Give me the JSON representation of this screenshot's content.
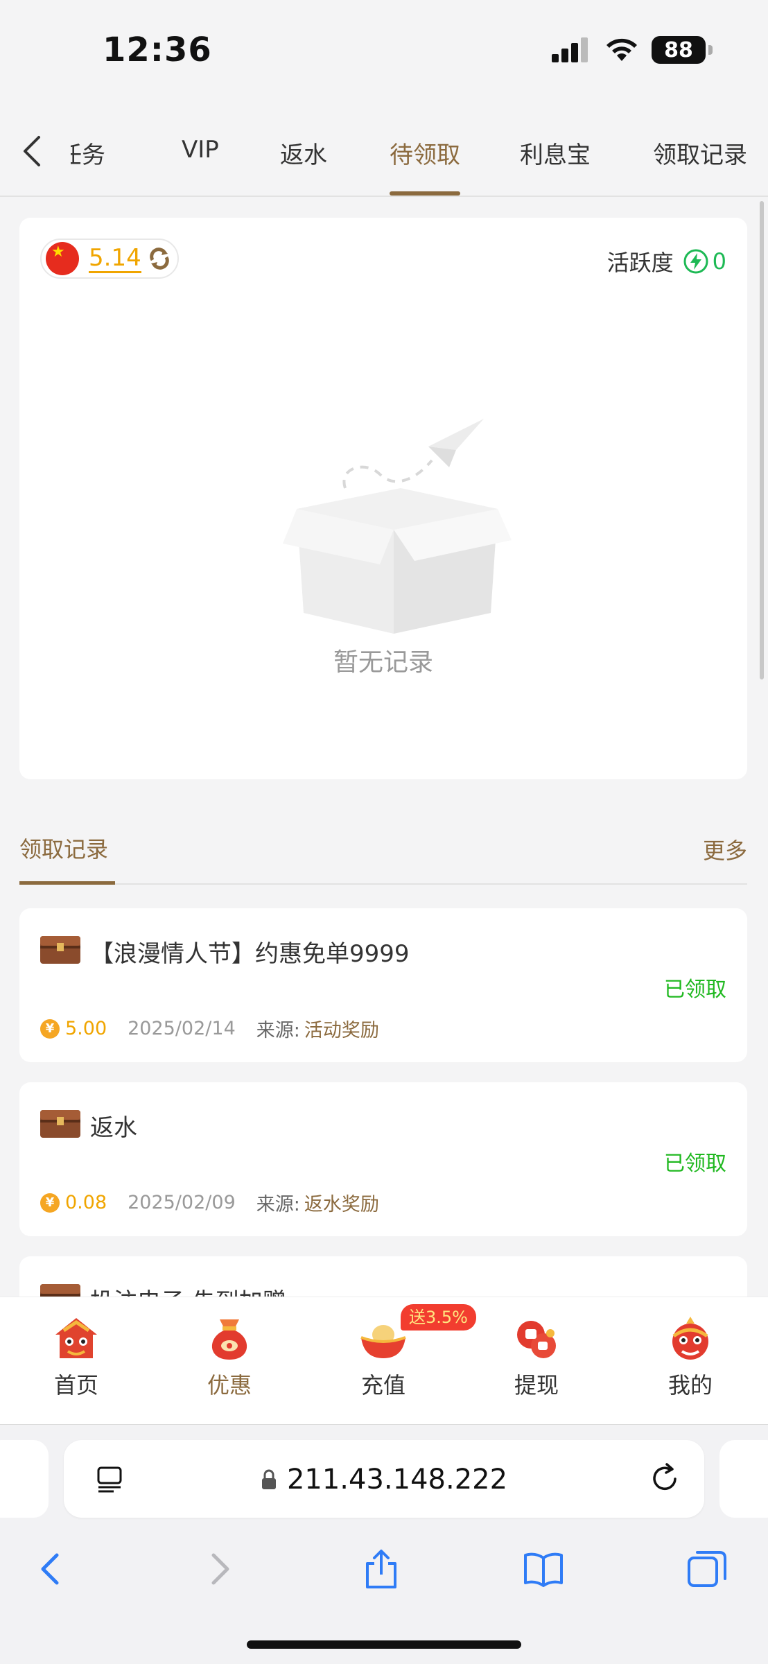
{
  "status_bar": {
    "time": "12:36",
    "battery": "88"
  },
  "tabs": [
    {
      "label": "任务"
    },
    {
      "label": "VIP"
    },
    {
      "label": "返水"
    },
    {
      "label": "待领取",
      "active": true
    },
    {
      "label": "利息宝"
    },
    {
      "label": "领取记录"
    }
  ],
  "card": {
    "balance": "5.14",
    "activity_label": "活跃度",
    "activity_value": "0",
    "empty_text": "暂无记录"
  },
  "records": {
    "title": "领取记录",
    "more": "更多",
    "items": [
      {
        "title": "【浪漫情人节】约惠免单9999",
        "status": "已领取",
        "amount": "5.00",
        "date": "2025/02/14",
        "source_label": "来源:",
        "source": "活动奖励"
      },
      {
        "title": "返水",
        "status": "已领取",
        "amount": "0.08",
        "date": "2025/02/09",
        "source_label": "来源:",
        "source": "返水奖励"
      },
      {
        "title": "投注电子 先到加赠"
      }
    ]
  },
  "bottom_nav": {
    "items": [
      {
        "label": "首页",
        "icon": "lion-home-icon"
      },
      {
        "label": "优惠",
        "icon": "red-pouch-icon",
        "active": true
      },
      {
        "label": "充值",
        "icon": "gold-ingot-icon"
      },
      {
        "label": "提现",
        "icon": "red-envelope-icon"
      },
      {
        "label": "我的",
        "icon": "lion-dance-icon"
      }
    ],
    "promo_badge": "送3.5%"
  },
  "browser": {
    "url": "211.43.148.222"
  },
  "colors": {
    "accent": "#8b6a3e",
    "gold": "#f0a500",
    "success": "#1fb81f",
    "activity": "#1db954",
    "badge": "#f23d2f"
  }
}
